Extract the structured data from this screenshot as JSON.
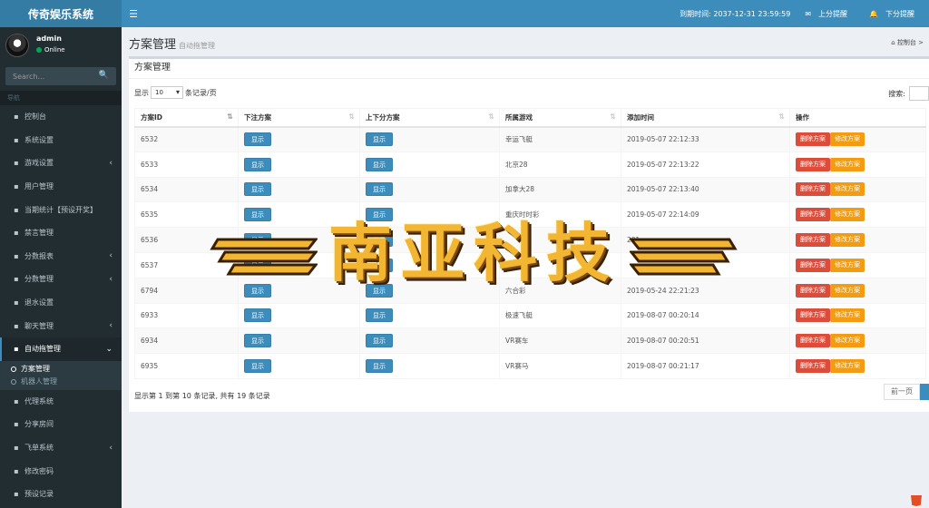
{
  "app": {
    "title": "传奇娱乐系统"
  },
  "topbar": {
    "menu_icon": "hamburger-icon",
    "expire": "到期时间: 2037-12-31 23:59:59",
    "up_reminder": "上分提醒",
    "down_reminder": "下分提醒"
  },
  "user": {
    "name": "admin",
    "status": "Online"
  },
  "search": {
    "placeholder": "Search..."
  },
  "nav": {
    "header": "导航",
    "items": [
      {
        "label": "控制台",
        "icon": "dashboard-icon",
        "caret": false
      },
      {
        "label": "系统设置",
        "icon": "gears-icon",
        "caret": false
      },
      {
        "label": "游戏设置",
        "icon": "gamepad-icon",
        "caret": true
      },
      {
        "label": "用户管理",
        "icon": "users-icon",
        "caret": false
      },
      {
        "label": "当期统计【预设开奖】",
        "icon": "chart-icon",
        "caret": false
      },
      {
        "label": "禁言管理",
        "icon": "warning-icon",
        "caret": false
      },
      {
        "label": "分数报表",
        "icon": "layers-icon",
        "caret": true
      },
      {
        "label": "分数管理",
        "icon": "layers-icon",
        "caret": true
      },
      {
        "label": "退水设置",
        "icon": "money-icon",
        "caret": false
      },
      {
        "label": "聊天管理",
        "icon": "chat-icon",
        "caret": true
      },
      {
        "label": "自动拖管理",
        "icon": "comment-icon",
        "caret": true,
        "active": true
      }
    ],
    "sub": [
      {
        "label": "方案管理",
        "active": true
      },
      {
        "label": "机器人管理",
        "active": false
      }
    ],
    "after": [
      {
        "label": "代理系统",
        "icon": "user-icon"
      },
      {
        "label": "分享房间",
        "icon": "share-icon"
      },
      {
        "label": "飞单系统",
        "icon": "send-icon",
        "caret": true
      },
      {
        "label": "修改密码",
        "icon": "cart-icon"
      },
      {
        "label": "预设记录",
        "icon": "record-icon"
      }
    ]
  },
  "page": {
    "title": "方案管理",
    "subtitle": "自动拖管理",
    "breadcrumb": "控制台"
  },
  "box": {
    "title": "方案管理"
  },
  "length": {
    "prefix": "显示",
    "value": "10",
    "suffix": "条记录/页"
  },
  "filter": {
    "label": "搜索:"
  },
  "table": {
    "columns": [
      "方案ID",
      "下注方案",
      "上下分方案",
      "所属游戏",
      "添加时间",
      "操作"
    ],
    "show_label": "显示",
    "delete_label": "删除方案",
    "edit_label": "修改方案",
    "rows": [
      {
        "id": "6532",
        "game": "幸运飞艇",
        "time": "2019-05-07 22:12:33"
      },
      {
        "id": "6533",
        "game": "北京28",
        "time": "2019-05-07 22:13:22"
      },
      {
        "id": "6534",
        "game": "加拿大28",
        "time": "2019-05-07 22:13:40"
      },
      {
        "id": "6535",
        "game": "重庆时时彩",
        "time": "2019-05-07 22:14:09"
      },
      {
        "id": "6536",
        "game": "",
        "time": "201"
      },
      {
        "id": "6537",
        "game": "",
        "time": ""
      },
      {
        "id": "6794",
        "game": "六合彩",
        "time": "2019-05-24 22:21:23"
      },
      {
        "id": "6933",
        "game": "极速飞艇",
        "time": "2019-08-07 00:20:14"
      },
      {
        "id": "6934",
        "game": "VR赛车",
        "time": "2019-08-07 00:20:51"
      },
      {
        "id": "6935",
        "game": "VR赛马",
        "time": "2019-08-07 00:21:17"
      }
    ]
  },
  "footer": {
    "info": "显示第 1 到第 10 条记录, 共有 19 条记录",
    "prev": "前一页"
  },
  "watermark": {
    "text": "南亚科技",
    "color": "#f2b632"
  }
}
